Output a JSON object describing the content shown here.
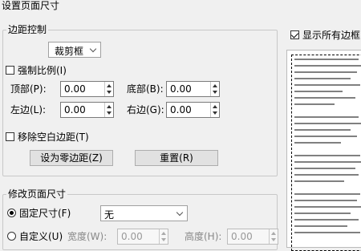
{
  "dialog": {
    "title": "设置页面尺寸"
  },
  "margins": {
    "legend": "边距控制",
    "mode_select": "裁剪框",
    "proportional_label": "强制比例(I)",
    "proportional_checked": false,
    "top_label": "顶部(P):",
    "top_value": "0.00",
    "bottom_label": "底部(B):",
    "bottom_value": "0.00",
    "left_label": "左边(L):",
    "left_value": "0.00",
    "right_label": "右边(G):",
    "right_value": "0.00",
    "remove_white_label": "移除空白边距(T)",
    "remove_white_checked": false,
    "set_zero_button": "设为零边距(Z)",
    "reset_button": "重置(R)"
  },
  "page_size": {
    "legend": "修改页面尺寸",
    "fixed_label": "固定尺寸(F)",
    "fixed_selected": true,
    "fixed_select": "无",
    "custom_label": "自定义(U)",
    "width_label": "宽度(W):",
    "width_value": "0.00",
    "height_label": "高度(H):",
    "height_value": "0.00"
  },
  "preview": {
    "show_all_label": "显示所有边框(A",
    "show_all_checked": true
  }
}
